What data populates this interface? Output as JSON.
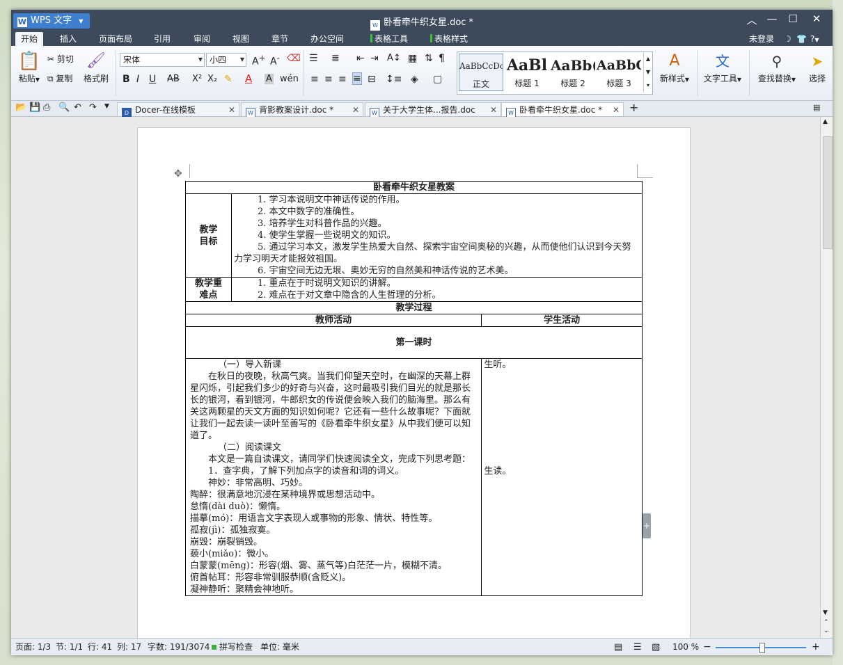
{
  "app": {
    "name": "WPS 文字",
    "doc_title": "卧看牵牛织女星.doc *"
  },
  "menu": {
    "tabs": [
      "开始",
      "插入",
      "页面布局",
      "引用",
      "审阅",
      "视图",
      "章节",
      "办公空间",
      "表格工具",
      "表格样式"
    ],
    "login": "未登录",
    "help": "?"
  },
  "ribbon": {
    "paste": "粘贴",
    "cut": "剪切",
    "copy": "复制",
    "format_painter": "格式刷",
    "font_name": "宋体",
    "font_size": "小四",
    "styles": [
      {
        "preview": "AaBbCcDc",
        "label": "正文"
      },
      {
        "preview": "AaBl",
        "label": "标题 1"
      },
      {
        "preview": "AaBb(",
        "label": "标题 2"
      },
      {
        "preview": "AaBbC",
        "label": "标题 3"
      }
    ],
    "new_style": "新样式",
    "text_tools": "文字工具",
    "find_replace": "查找替换",
    "select": "选择"
  },
  "doc_tabs": [
    {
      "label": "Docer-在线模板"
    },
    {
      "label": "背影教案设计.doc *"
    },
    {
      "label": "关于大学生体...报告.doc"
    },
    {
      "label": "卧看牵牛织女星.doc *"
    }
  ],
  "document": {
    "title": "卧看牵牛织女星教案",
    "goals_label": "教学目标",
    "goals": [
      "1.  学习本说明文中神话传说的作用。",
      "2.  本文中数字的准确性。",
      "3.  培养学生对科普作品的兴趣。",
      "4.  使学生掌握一些说明文的知识。",
      "5.  通过学习本文，激发学生热爱大自然、探索宇宙空间奥秘的兴趣，从而使他们认识到今天努力学习明天才能报效祖国。",
      "6.  宇宙空间无边无垠、奥妙无穷的自然美和神话传说的艺术美。"
    ],
    "keypoints_label": "教学重难点",
    "keypoints": [
      "1.  重点在于时说明文知识的讲解。",
      "2.  难点在于对文章中隐含的人生哲理的分析。"
    ],
    "process_label": "教学过程",
    "teacher_col": "教师活动",
    "student_col": "学生活动",
    "lesson": "第一课时",
    "teacher_text": [
      "（一）导入新课",
      "在秋日的夜晚，秋高气爽。当我们仰望天空时，在幽深的天幕上群星闪烁，引起我们多少的好奇与兴奋，这时最吸引我们目光的就是那长长的银河，看到银河，牛郎织女的传说便会映入我们的脑海里。那么有关这两颗星的天文方面的知识如何呢？它还有一些什么故事呢？下面就让我们一起去读一读叶至善写的《卧看牵牛织女星》从中我们便可以知道了。",
      "（二）阅读课文",
      "本文是一篇自读课文，请同学们快速阅读全文，完成下列思考题：",
      "1．查字典，了解下列加点字的读音和词的词义。",
      "神妙：非常高明、巧妙。",
      "陶醉：很满意地沉浸在某种境界或思想活动中。",
      "怠惰(dài duò)：懒惰。",
      "描摹(mó)：用语言文字表现人或事物的形象、情状、特性等。",
      "孤寂(jì)：孤独寂寞。",
      "崩毁：崩裂销毁。",
      "藐小(miǎo)：微小。",
      "白蒙蒙(mēng)：形容(烟、雾、蒸气等)白茫茫一片，模糊不清。",
      "俯首帖耳：形容非常驯服恭顺(含贬义)。",
      "凝神静听：聚精会神地听。"
    ],
    "student_text_1": "生听。",
    "student_text_2": "生读。"
  },
  "status": {
    "page": "页面: 1/3",
    "section": "节: 1/1",
    "row": "行: 41",
    "col": "列: 17",
    "words": "字数: 191/3074",
    "spell": "拼写检查",
    "unit": "单位: 毫米",
    "zoom": "100 %"
  }
}
